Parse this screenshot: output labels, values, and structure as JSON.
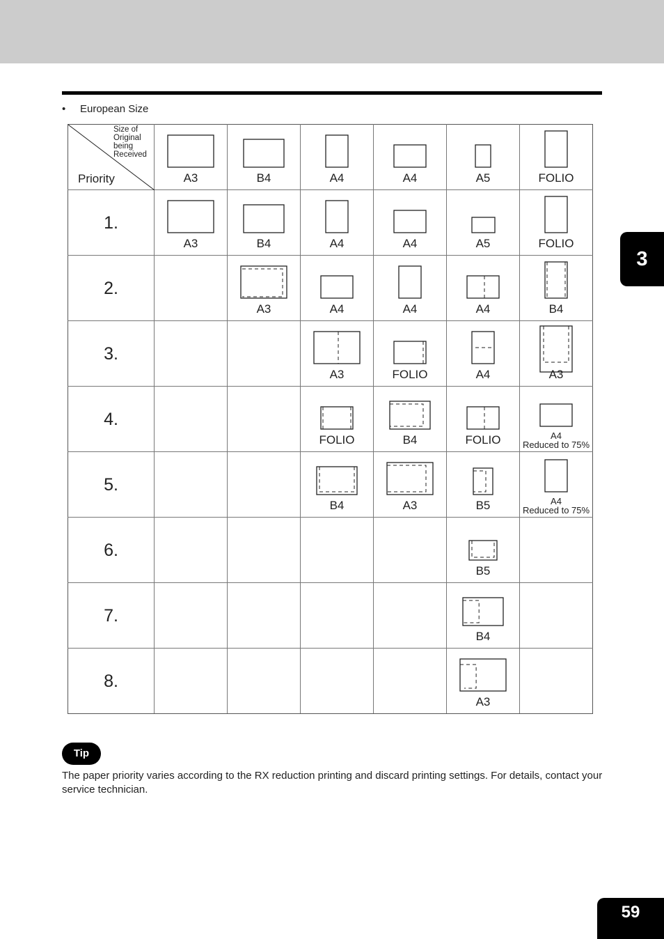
{
  "page": {
    "chapter_tab": "3",
    "page_number": "59"
  },
  "section": {
    "bullet": "•",
    "title": "European Size"
  },
  "table": {
    "corner": {
      "size_header": "Size of Original being Received",
      "size_header_lines": [
        "Size of",
        "Original",
        "being",
        "Received"
      ],
      "priority_header": "Priority"
    },
    "header_row": [
      {
        "label": "A3",
        "icon": {
          "shape": "land-large",
          "dash": "none"
        }
      },
      {
        "label": "B4",
        "icon": {
          "shape": "land-med",
          "dash": "none"
        }
      },
      {
        "label": "A4",
        "icon": {
          "shape": "port-med",
          "dash": "none"
        }
      },
      {
        "label": "A4",
        "icon": {
          "shape": "land-small",
          "dash": "none"
        }
      },
      {
        "label": "A5",
        "icon": {
          "shape": "port-small",
          "dash": "none"
        }
      },
      {
        "label": "FOLIO",
        "icon": {
          "shape": "port-tall",
          "dash": "none"
        }
      }
    ],
    "rows": [
      {
        "rank": "1.",
        "cells": [
          {
            "label": "A3",
            "icon": {
              "shape": "land-large",
              "dash": "none"
            }
          },
          {
            "label": "B4",
            "icon": {
              "shape": "land-med",
              "dash": "none"
            }
          },
          {
            "label": "A4",
            "icon": {
              "shape": "port-med",
              "dash": "none"
            }
          },
          {
            "label": "A4",
            "icon": {
              "shape": "land-small",
              "dash": "none"
            }
          },
          {
            "label": "A5",
            "icon": {
              "shape": "land-tiny",
              "dash": "none"
            }
          },
          {
            "label": "FOLIO",
            "icon": {
              "shape": "port-tall",
              "dash": "none"
            }
          }
        ]
      },
      {
        "rank": "2.",
        "cells": [
          null,
          {
            "label": "A3",
            "icon": {
              "shape": "land-large",
              "dash": "inset-tr"
            }
          },
          {
            "label": "A4",
            "icon": {
              "shape": "land-small",
              "dash": "none"
            }
          },
          {
            "label": "A4",
            "icon": {
              "shape": "port-med",
              "dash": "none"
            }
          },
          {
            "label": "A4",
            "icon": {
              "shape": "land-small",
              "dash": "center-v"
            }
          },
          {
            "label": "B4",
            "icon": {
              "shape": "port-tall",
              "dash": "sides-v"
            }
          }
        ]
      },
      {
        "rank": "3.",
        "cells": [
          null,
          null,
          {
            "label": "A3",
            "icon": {
              "shape": "land-large",
              "dash": "center-v"
            }
          },
          {
            "label": "FOLIO",
            "icon": {
              "shape": "land-small",
              "dash": "right-v"
            }
          },
          {
            "label": "A4",
            "icon": {
              "shape": "port-med",
              "dash": "center-h"
            }
          },
          {
            "label": "A3",
            "icon": {
              "shape": "port-xtall",
              "dash": "inset-top"
            }
          }
        ]
      },
      {
        "rank": "4.",
        "cells": [
          null,
          null,
          {
            "label": "FOLIO",
            "icon": {
              "shape": "land-small",
              "dash": "sides-v"
            }
          },
          {
            "label": "B4",
            "icon": {
              "shape": "land-med",
              "dash": "inset-tl"
            }
          },
          {
            "label": "FOLIO",
            "icon": {
              "shape": "land-small",
              "dash": "center-v"
            }
          },
          {
            "label": "A4",
            "sublabel": "Reduced to 75%",
            "icon": {
              "shape": "land-small",
              "dash": "none"
            }
          }
        ]
      },
      {
        "rank": "5.",
        "cells": [
          null,
          null,
          {
            "label": "B4",
            "icon": {
              "shape": "land-med",
              "dash": "inset-bottom"
            }
          },
          {
            "label": "A3",
            "icon": {
              "shape": "land-large",
              "dash": "inset-tl"
            }
          },
          {
            "label": "B5",
            "icon": {
              "shape": "port-small2",
              "dash": "inset-tl"
            }
          },
          {
            "label": "A4",
            "sublabel": "Reduced to 75%",
            "icon": {
              "shape": "port-med",
              "dash": "none"
            }
          }
        ]
      },
      {
        "rank": "6.",
        "cells": [
          null,
          null,
          null,
          null,
          {
            "label": "B5",
            "icon": {
              "shape": "land-tiny2",
              "dash": "inset-bottom"
            }
          },
          null
        ]
      },
      {
        "rank": "7.",
        "cells": [
          null,
          null,
          null,
          null,
          {
            "label": "B4",
            "icon": {
              "shape": "land-med",
              "dash": "left-half"
            }
          },
          null
        ]
      },
      {
        "rank": "8.",
        "cells": [
          null,
          null,
          null,
          null,
          {
            "label": "A3",
            "icon": {
              "shape": "land-large",
              "dash": "left-third"
            }
          },
          null
        ]
      }
    ]
  },
  "tip": {
    "badge": "Tip",
    "text": "The paper priority varies according to the RX reduction printing and discard printing settings. For details, contact your service technician."
  }
}
